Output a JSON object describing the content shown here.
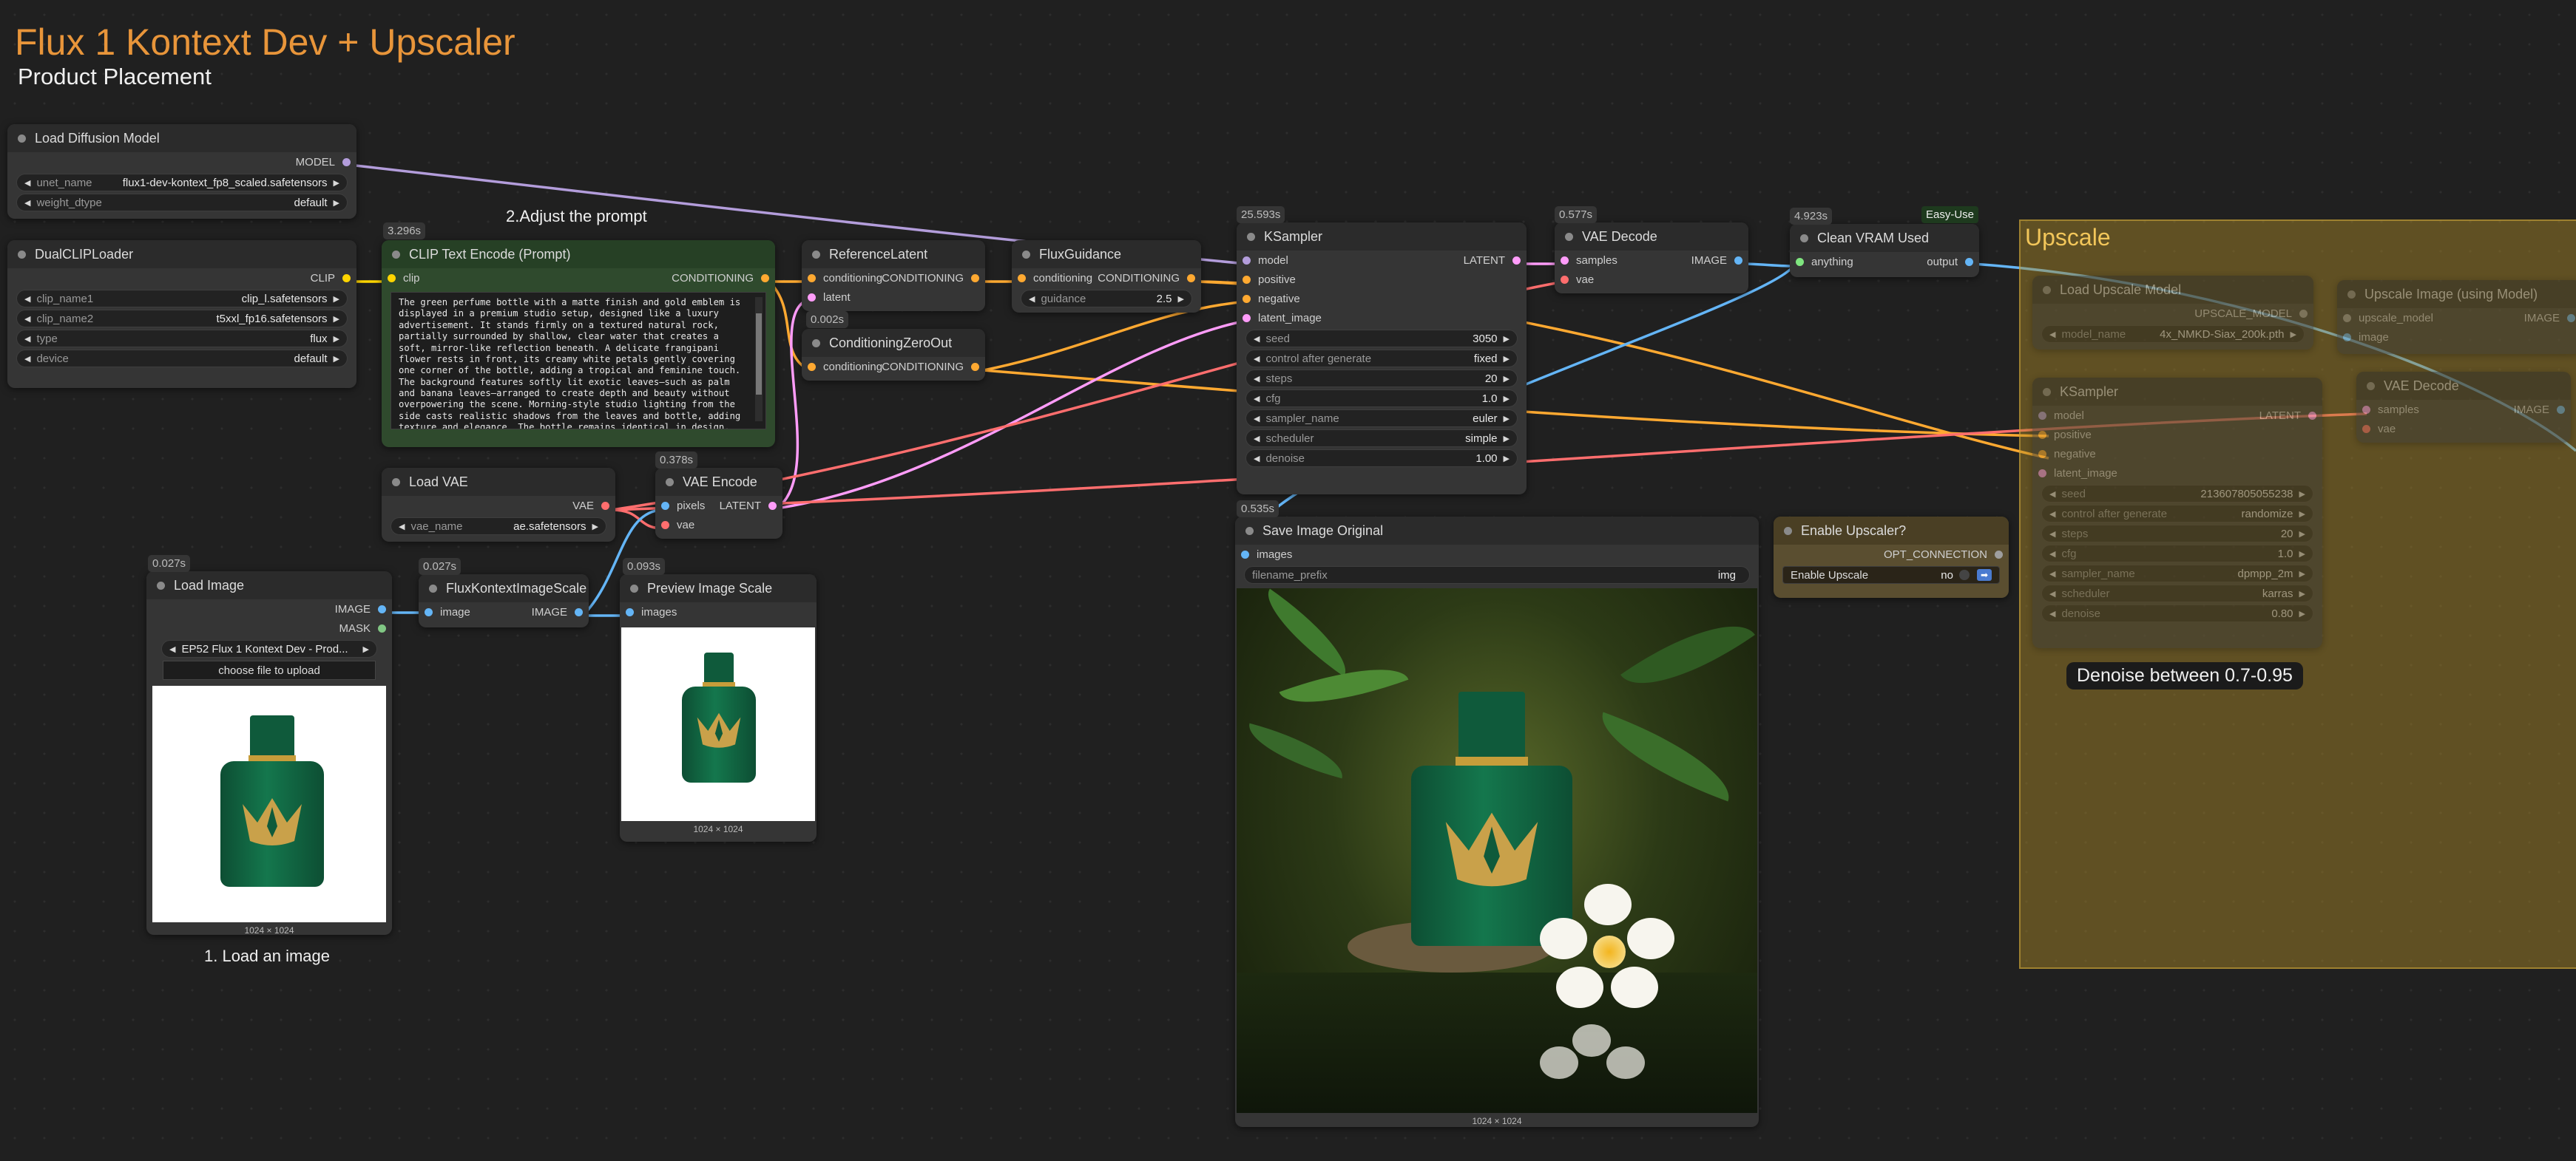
{
  "header": {
    "title": "Flux 1 Kontext Dev + Upscaler",
    "subtitle": "Product Placement"
  },
  "notes": {
    "adjust_prompt": "2.Adjust the prompt",
    "load_image": "1. Load an image",
    "denoise": "Denoise between 0.7-0.95",
    "easy_use": "Easy-Use"
  },
  "timings": {
    "clip_text_encode": "3.296s",
    "reference_latent": "0.002s",
    "vae_encode": "0.378s",
    "load_image": "0.027s",
    "flux_kontext_scale": "0.027s",
    "preview_scale": "0.093s",
    "ksampler": "25.593s",
    "vae_decode": "0.577s",
    "clean_vram": "4.923s",
    "save_image": "0.535s"
  },
  "nodes": {
    "load_diffusion_model": {
      "title": "Load Diffusion Model",
      "output": "MODEL",
      "widgets": [
        {
          "name": "unet_name",
          "value": "flux1-dev-kontext_fp8_scaled.safetensors"
        },
        {
          "name": "weight_dtype",
          "value": "default"
        }
      ]
    },
    "dual_clip_loader": {
      "title": "DualCLIPLoader",
      "output": "CLIP",
      "widgets": [
        {
          "name": "clip_name1",
          "value": "clip_l.safetensors"
        },
        {
          "name": "clip_name2",
          "value": "t5xxl_fp16.safetensors"
        },
        {
          "name": "type",
          "value": "flux"
        },
        {
          "name": "device",
          "value": "default"
        }
      ]
    },
    "clip_text_encode": {
      "title": "CLIP Text Encode (Prompt)",
      "input": "clip",
      "output": "CONDITIONING",
      "text": "The green perfume bottle with a matte finish and gold emblem is displayed in a premium studio setup, designed like a luxury advertisement. It stands firmly on a textured natural rock, partially surrounded by shallow, clear water that creates a soft, mirror-like reflection beneath. A delicate frangipani flower rests in front, its creamy white petals gently covering one corner of the bottle, adding a tropical and feminine touch. The background features softly lit exotic leaves—such as palm and banana leaves—arranged to create depth and beauty without overpowering the scene. Morning-style studio lighting from the side casts realistic shadows from the leaves and bottle, adding texture and elegance. The bottle remains identical in design, with consistent and realistic proportions, captured with a full-frame"
    },
    "reference_latent": {
      "title": "ReferenceLatent",
      "inputs": [
        "conditioning",
        "latent"
      ],
      "output": "CONDITIONING"
    },
    "conditioning_zero_out": {
      "title": "ConditioningZeroOut",
      "input": "conditioning",
      "output": "CONDITIONING"
    },
    "flux_guidance": {
      "title": "FluxGuidance",
      "input": "conditioning",
      "output": "CONDITIONING",
      "widgets": [
        {
          "name": "guidance",
          "value": "2.5"
        }
      ]
    },
    "load_vae": {
      "title": "Load VAE",
      "output": "VAE",
      "widgets": [
        {
          "name": "vae_name",
          "value": "ae.safetensors"
        }
      ]
    },
    "vae_encode": {
      "title": "VAE Encode",
      "inputs": [
        "pixels",
        "vae"
      ],
      "output": "LATENT"
    },
    "load_image": {
      "title": "Load Image",
      "outputs": [
        "IMAGE",
        "MASK"
      ],
      "widgets": [
        {
          "name": "",
          "value": "EP52 Flux 1 Kontext Dev - Prod..."
        }
      ],
      "upload_label": "choose file to upload",
      "caption": "1024 × 1024"
    },
    "flux_kontext_image_scale": {
      "title": "FluxKontextImageScale",
      "input": "image",
      "output": "IMAGE"
    },
    "preview_image_scale": {
      "title": "Preview Image Scale",
      "input": "images",
      "caption": "1024 × 1024"
    },
    "ksampler": {
      "title": "KSampler",
      "inputs": [
        "model",
        "positive",
        "negative",
        "latent_image"
      ],
      "output": "LATENT",
      "widgets": [
        {
          "name": "seed",
          "value": "3050"
        },
        {
          "name": "control after generate",
          "value": "fixed"
        },
        {
          "name": "steps",
          "value": "20"
        },
        {
          "name": "cfg",
          "value": "1.0"
        },
        {
          "name": "sampler_name",
          "value": "euler"
        },
        {
          "name": "scheduler",
          "value": "simple"
        },
        {
          "name": "denoise",
          "value": "1.00"
        }
      ]
    },
    "vae_decode": {
      "title": "VAE Decode",
      "inputs": [
        "samples",
        "vae"
      ],
      "output": "IMAGE"
    },
    "clean_vram": {
      "title": "Clean VRAM Used",
      "input": "anything",
      "output": "output"
    },
    "save_image": {
      "title": "Save Image Original",
      "input": "images",
      "widgets": [
        {
          "name": "filename_prefix",
          "value": "img"
        }
      ],
      "caption": "1024 × 1024"
    },
    "enable_upscaler": {
      "title": "Enable Upscaler?",
      "output": "OPT_CONNECTION",
      "widgets": [
        {
          "name": "Enable Upscale",
          "value": "no"
        }
      ]
    }
  },
  "upscale_group": {
    "title": "Upscale",
    "load_upscale_model": {
      "title": "Load Upscale Model",
      "output": "UPSCALE_MODEL",
      "widgets": [
        {
          "name": "model_name",
          "value": "4x_NMKD-Siax_200k.pth"
        }
      ]
    },
    "upscale_image": {
      "title": "Upscale Image (using Model)",
      "inputs": [
        "upscale_model",
        "image"
      ],
      "output": "IMAGE"
    },
    "ksampler": {
      "title": "KSampler",
      "inputs": [
        "model",
        "positive",
        "negative",
        "latent_image"
      ],
      "output": "LATENT",
      "widgets": [
        {
          "name": "seed",
          "value": "213607805055238"
        },
        {
          "name": "control after generate",
          "value": "randomize"
        },
        {
          "name": "steps",
          "value": "20"
        },
        {
          "name": "cfg",
          "value": "1.0"
        },
        {
          "name": "sampler_name",
          "value": "dpmpp_2m"
        },
        {
          "name": "scheduler",
          "value": "karras"
        },
        {
          "name": "denoise",
          "value": "0.80"
        }
      ]
    },
    "vae_decode": {
      "title": "VAE Decode",
      "inputs": [
        "samples",
        "vae"
      ],
      "output": "IMAGE"
    }
  },
  "colors": {
    "model": "#b39ddb",
    "clip": "#ffd500",
    "conditioning": "#ffa931",
    "latent": "#ff9cf9",
    "vae": "#ff6e6e",
    "image": "#64b5f6",
    "mask": "#81c784",
    "any": "#7fe57f",
    "group_title": "#f2c65a",
    "title_orange": "#e8953a"
  }
}
